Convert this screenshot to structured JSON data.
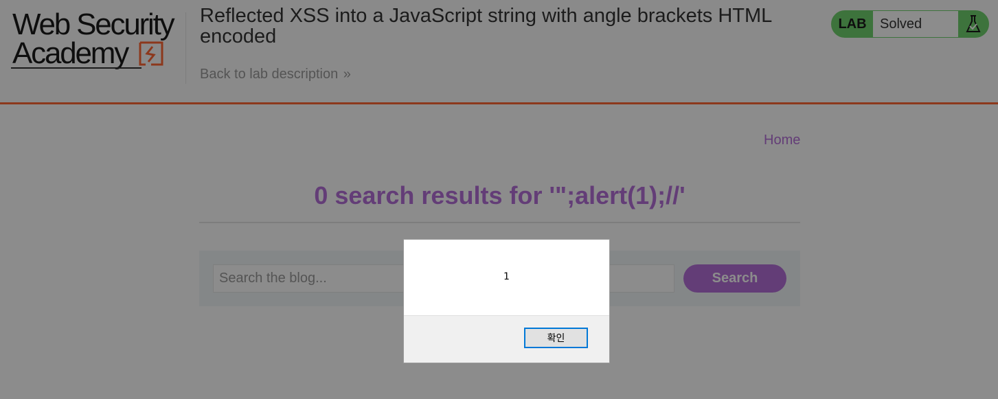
{
  "header": {
    "logo": {
      "line1": "Web Security",
      "line2": "Academy"
    },
    "title": "Reflected XSS into a JavaScript string with angle brackets HTML encoded",
    "back_link": "Back to lab description",
    "back_chevron": "»",
    "lab_badge": "LAB",
    "lab_state": "Solved",
    "flask_icon": "flask-check-icon"
  },
  "nav": {
    "home": "Home"
  },
  "results": {
    "heading": "0 search results for '\";alert(1);//'"
  },
  "search": {
    "placeholder": "Search the blog...",
    "value": "",
    "button": "Search"
  },
  "dialog": {
    "message": "1",
    "ok_label": "확인"
  },
  "colors": {
    "accent": "#ff6633",
    "link_purple": "#b56fd9",
    "solved_green": "#70d16d",
    "dialog_focus": "#0078d7"
  }
}
